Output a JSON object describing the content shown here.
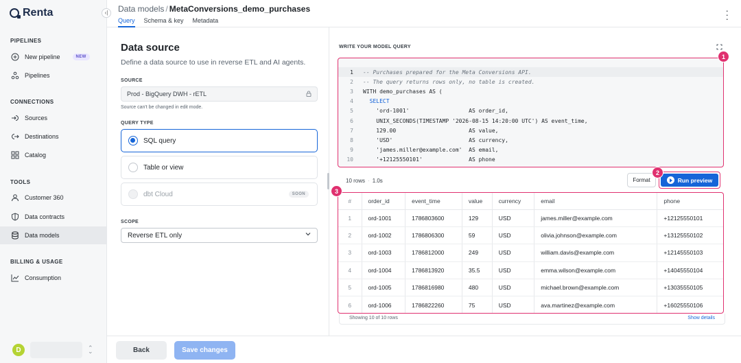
{
  "app": {
    "logo_text": "Renta"
  },
  "sidebar": {
    "sections": [
      {
        "title": "PIPELINES"
      },
      {
        "title": "CONNECTIONS"
      },
      {
        "title": "TOOLS"
      },
      {
        "title": "BILLING & USAGE"
      }
    ],
    "items": [
      {
        "label": "New pipeline",
        "icon": "plus-circle-icon",
        "badge": "NEW"
      },
      {
        "label": "Pipelines",
        "icon": "pipelines-icon"
      },
      {
        "label": "Sources",
        "icon": "source-arrow-icon"
      },
      {
        "label": "Destinations",
        "icon": "destination-arrow-icon"
      },
      {
        "label": "Catalog",
        "icon": "grid-icon"
      },
      {
        "label": "Customer 360",
        "icon": "person-icon"
      },
      {
        "label": "Data contracts",
        "icon": "shield-icon"
      },
      {
        "label": "Data models",
        "icon": "database-icon",
        "active": true
      },
      {
        "label": "Consumption",
        "icon": "chart-line-icon"
      }
    ],
    "user": {
      "avatar_letter": "D"
    }
  },
  "header": {
    "breadcrumb_parent": "Data models",
    "breadcrumb_sep": "/",
    "title": "MetaConversions_demo_purchases",
    "tabs": [
      {
        "label": "Query",
        "active": true
      },
      {
        "label": "Schema & key"
      },
      {
        "label": "Metadata"
      }
    ]
  },
  "data_source": {
    "title": "Data source",
    "subtitle": "Define a data source to use in reverse ETL and AI agents.",
    "source_label": "SOURCE",
    "source_value": "Prod - BigQuery DWH - rETL",
    "source_hint": "Source can't be changed in edit mode.",
    "query_type_label": "QUERY TYPE",
    "options": [
      {
        "label": "SQL query",
        "selected": true
      },
      {
        "label": "Table or view"
      },
      {
        "label": "dbt Cloud",
        "badge": "SOON",
        "disabled": true
      }
    ],
    "scope_label": "SCOPE",
    "scope_value": "Reverse ETL only"
  },
  "editor": {
    "header": "WRITE YOUR MODEL QUERY",
    "line_numbers": [
      "1",
      "2",
      "3",
      "4",
      "5",
      "6",
      "7",
      "8",
      "9",
      "10"
    ],
    "lines": [
      "-- Purchases prepared for the Meta Conversions API.",
      "-- The query returns rows only, no table is created.",
      "WITH demo_purchases AS (",
      "  SELECT",
      "    'ord-1001'                  AS order_id,",
      "    UNIX_SECONDS(TIMESTAMP '2026-08-15 14:20:00 UTC') AS event_time,",
      "    129.00                      AS value,",
      "    'USD'                       AS currency,",
      "    'james.miller@example.com'  AS email,",
      "    '+12125550101'              AS phone"
    ]
  },
  "results": {
    "rows_count": "10 rows",
    "duration": "1.0s",
    "format_label": "Format",
    "run_label": "Run preview",
    "columns": [
      "#",
      "order_id",
      "event_time",
      "value",
      "currency",
      "email",
      "phone"
    ],
    "rows": [
      [
        "1",
        "ord-1001",
        "1786803600",
        "129",
        "USD",
        "james.miller@example.com",
        "+12125550101"
      ],
      [
        "2",
        "ord-1002",
        "1786806300",
        "59",
        "USD",
        "olivia.johnson@example.com",
        "+13125550102"
      ],
      [
        "3",
        "ord-1003",
        "1786812000",
        "249",
        "USD",
        "william.davis@example.com",
        "+12145550103"
      ],
      [
        "4",
        "ord-1004",
        "1786813920",
        "35.5",
        "USD",
        "emma.wilson@example.com",
        "+14045550104"
      ],
      [
        "5",
        "ord-1005",
        "1786816980",
        "480",
        "USD",
        "michael.brown@example.com",
        "+13035550105"
      ],
      [
        "6",
        "ord-1006",
        "1786822260",
        "75",
        "USD",
        "ava.martinez@example.com",
        "+16025550106"
      ]
    ],
    "showing": "Showing 10 of 10 rows",
    "show_details": "Show details"
  },
  "callouts": [
    "1",
    "2",
    "3"
  ],
  "footer": {
    "back_label": "Back",
    "save_label": "Save changes"
  },
  "colors": {
    "accent": "#1565d8",
    "highlight": "#e0306f",
    "save_disabled": "#8fb4f2"
  }
}
